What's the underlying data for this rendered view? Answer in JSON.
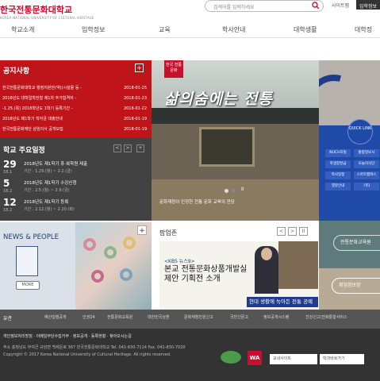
{
  "header": {
    "logo": "한국전통문화대학교",
    "logo_sub": "KOREA NATIONAL UNIVERSITY OF CULTURAL HERITAGE",
    "search_placeholder": "검색어를 입력하세요",
    "sitemap": "사이트맵",
    "admission": "입학정보"
  },
  "nav": [
    "학교소개",
    "입학정보",
    "교육",
    "학사안내",
    "대학생활",
    "대학정"
  ],
  "notice": {
    "title": "공지사항",
    "plus": "+",
    "items": [
      {
        "t": "한국전통문화대학교 행정지원안(약)(시설물 등 -",
        "d": "2018-01-25"
      },
      {
        "t": "2018년도 대학입학전형 제1차 추가합격자 -",
        "d": "2018-01-23"
      },
      {
        "t": "-1.25.(목) 2018학년도 1학기 등록기간 -",
        "d": "2018-01-22"
      },
      {
        "t": "2018년도 제1학기 학자금 대출안내",
        "d": "2018-01-19"
      },
      {
        "t": "한국전통문화재단 상임이사 공개모집",
        "d": "2018-01-19"
      }
    ]
  },
  "schedule": {
    "title": "학교 주요일정",
    "prev": "<",
    "next": ">",
    "plus": "+",
    "items": [
      {
        "day": "29",
        "mon": "18.1",
        "title": "2018년도 제1학기 휴·복학원 제출",
        "period": "기간 : 1.29.(월) ~ 2.2.(금)"
      },
      {
        "day": "5",
        "mon": "18.2",
        "title": "2018년도 제1학기 수강신청",
        "period": "기간 : 2.5.(월) ~ 2.9.(금)"
      },
      {
        "day": "12",
        "mon": "18.2",
        "title": "2018년도 제1학기 등록",
        "period": "기간 : 2.12.(월) ~ 2.20.(화)"
      }
    ]
  },
  "hero": {
    "tag": "한국 전통 문화",
    "text": "삶의숨에는 전통",
    "caption": "문화재청이 인정한 전통 문화 교육의 전당",
    "dot": "II"
  },
  "quick": {
    "title": "QUICK LINK",
    "items": [
      "NUCH포털",
      "통합정보시",
      "학생증발급",
      "오늘의식단",
      "학사일정",
      "스마트캠퍼스",
      "챗봇안내",
      "기타"
    ]
  },
  "news": {
    "title": "NEWS & PEOPLE",
    "more": "MORE",
    "plus": "+"
  },
  "popup": {
    "title": "팝업존",
    "prev": "<",
    "next": ">",
    "pause": "II",
    "kbs": "<KBS 뉴스9>",
    "line": "본교 전통문화상품개발실 제안 기획전 소개",
    "bar": "현대 생활에 녹아든 전통 공예"
  },
  "right": {
    "trad": "전통문화교육원",
    "job": "취업정보망"
  },
  "footer": {
    "label": "유관",
    "links": [
      "예산집행공개",
      "인권24",
      "전통문화교육원",
      "대한민국상훈",
      "문화재청민원신고",
      "국민신문고",
      "정보공개시스템",
      "건강신고(전화통합서비스"
    ],
    "lines": [
      "개인정보처리방침 · 이메일무단수집거부 · 정보공개 · 등록현황 · 찾아오시는길",
      "주소 충청남도 부여군 규암면 백제문로 367 한국전통문화대학교 Tel. 041-830-7114 Fax. 041-830-7020",
      "Copyright © 2017 Korea National University of Cultural Heritage. All rights reserved."
    ],
    "badge": "WA",
    "select1": "교내사이트",
    "select2": "학과바로가기"
  }
}
